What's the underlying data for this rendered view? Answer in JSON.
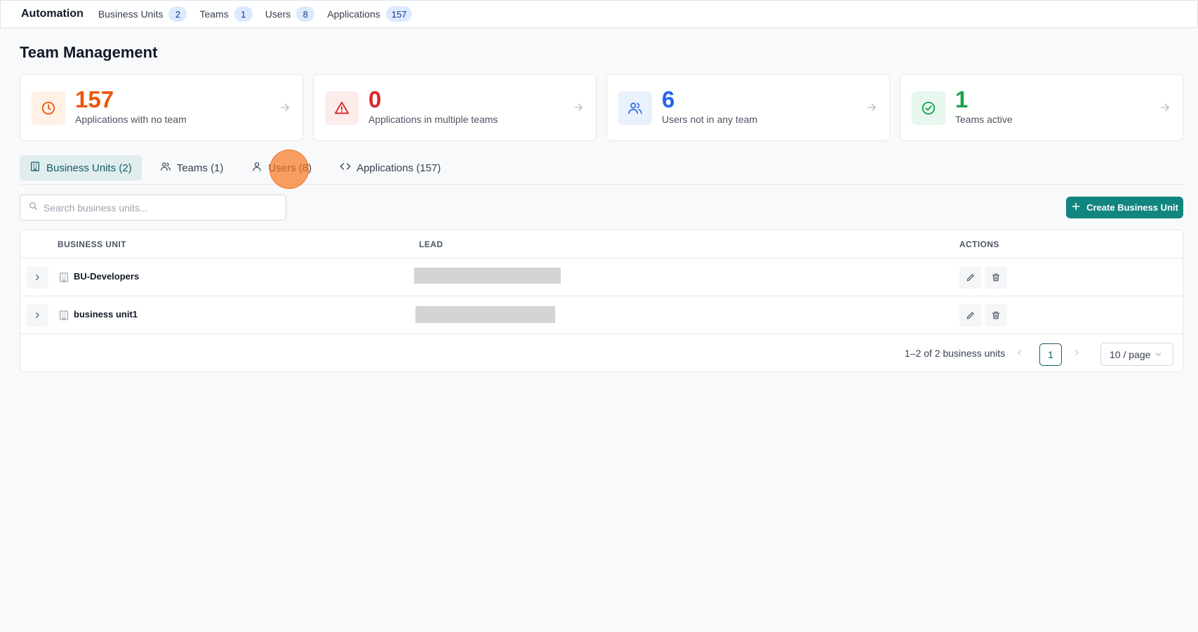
{
  "topbar": {
    "brand": "Automation",
    "nav": [
      {
        "label": "Business Units",
        "count": "2"
      },
      {
        "label": "Teams",
        "count": "1"
      },
      {
        "label": "Users",
        "count": "8"
      },
      {
        "label": "Applications",
        "count": "157"
      }
    ]
  },
  "page": {
    "title": "Team Management"
  },
  "stats": [
    {
      "value": "157",
      "label": "Applications with no team",
      "icon": "clock-icon",
      "color": "#ea580c",
      "bg": "#fff1e6"
    },
    {
      "value": "0",
      "label": "Applications in multiple teams",
      "icon": "warning-icon",
      "color": "#dc2626",
      "bg": "#fdecec"
    },
    {
      "value": "6",
      "label": "Users not in any team",
      "icon": "users-icon",
      "color": "#2563eb",
      "bg": "#e9f1fd"
    },
    {
      "value": "1",
      "label": "Teams active",
      "icon": "check-circle-icon",
      "color": "#16a34a",
      "bg": "#e8f7ee"
    }
  ],
  "tabs": [
    {
      "label": "Business Units (2)",
      "icon": "building-icon",
      "active": true
    },
    {
      "label": "Teams (1)",
      "icon": "users-icon",
      "active": false
    },
    {
      "label": "Users (8)",
      "icon": "user-icon",
      "active": false
    },
    {
      "label": "Applications (157)",
      "icon": "code-icon",
      "active": false
    }
  ],
  "search": {
    "placeholder": "Search business units..."
  },
  "create_button": "Create Business Unit",
  "table": {
    "columns": [
      "BUSINESS UNIT",
      "LEAD",
      "ACTIONS"
    ],
    "rows": [
      {
        "name": "BU-Developers",
        "lead": ""
      },
      {
        "name": "business unit1",
        "lead": ""
      }
    ]
  },
  "pagination": {
    "range_text": "1–2 of 2 business units",
    "current_page": "1",
    "per_page": "10 / page"
  }
}
